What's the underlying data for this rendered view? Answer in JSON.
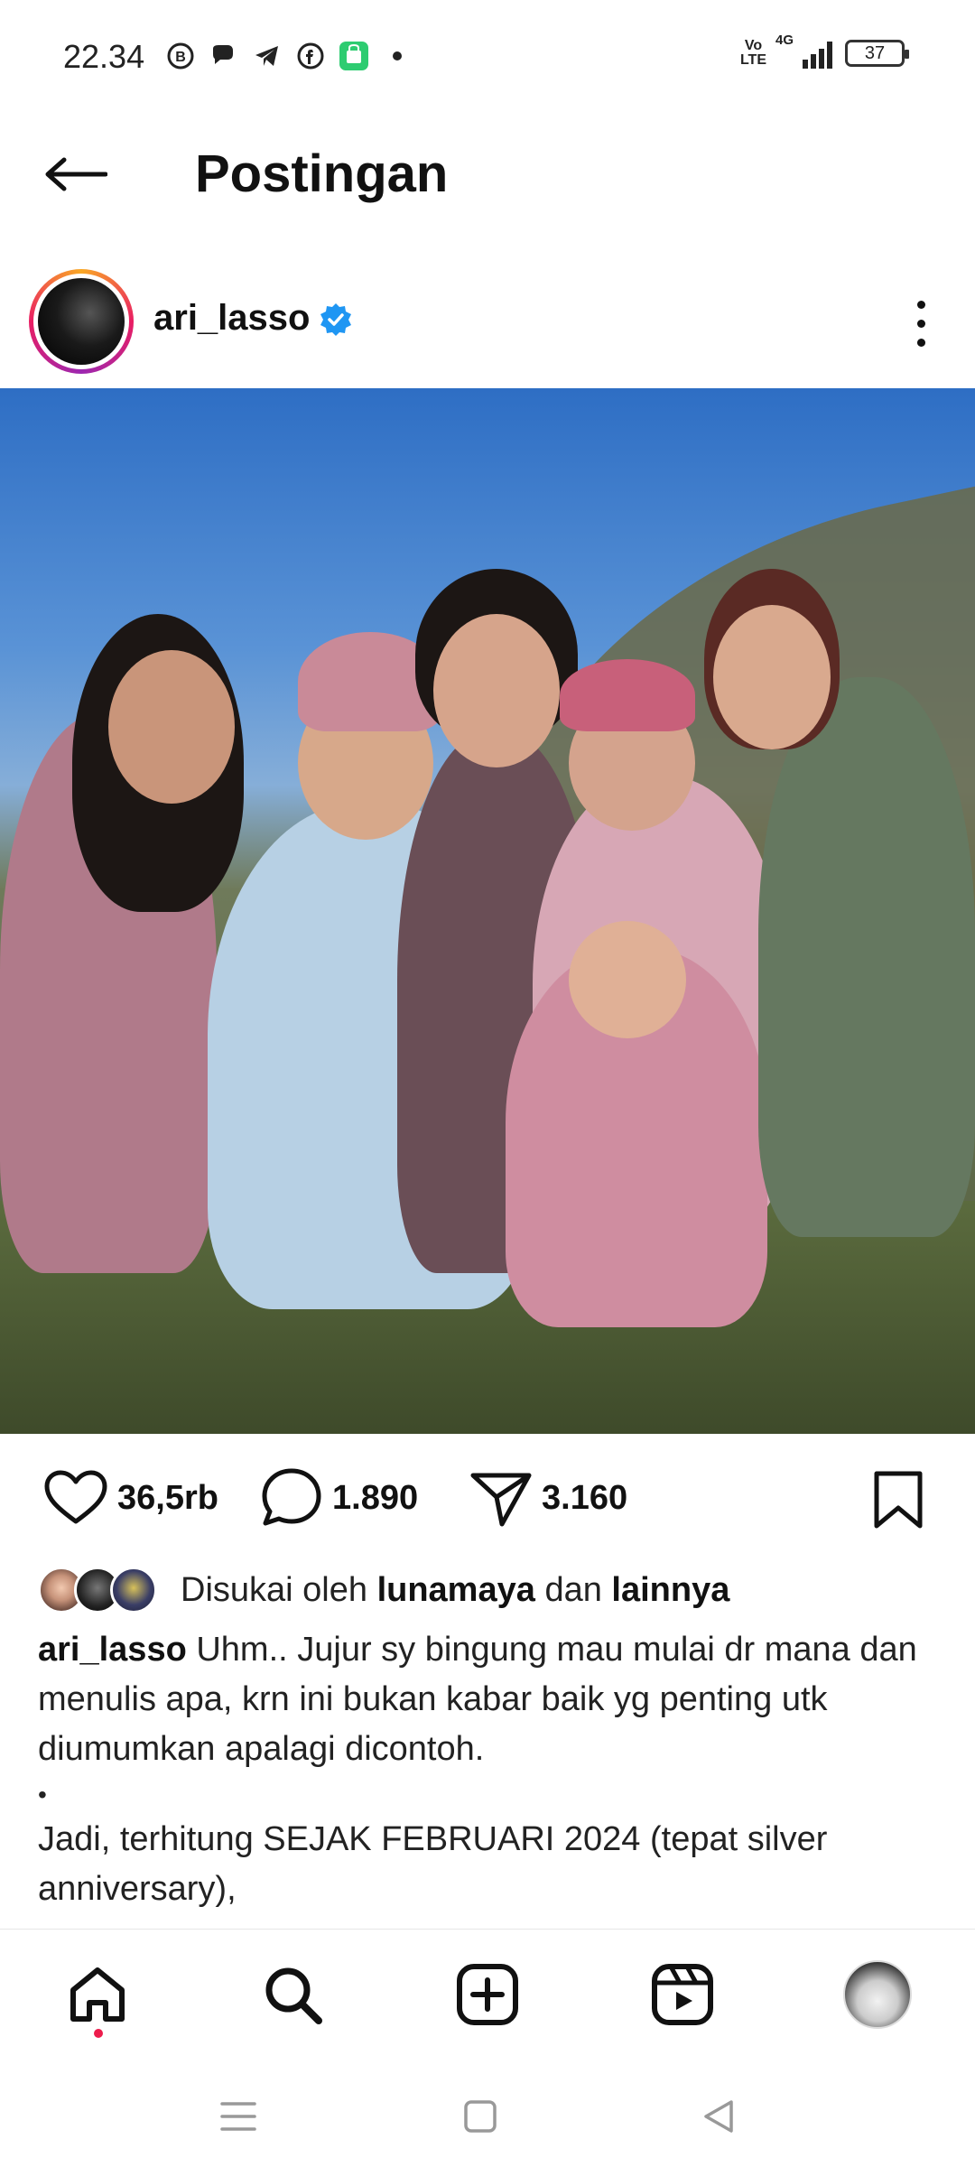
{
  "status_bar": {
    "time": "22.34",
    "network": "4G",
    "volte_top": "Vo",
    "volte_bottom": "LTE",
    "battery": "37"
  },
  "header": {
    "title": "Postingan"
  },
  "post": {
    "username": "ari_lasso",
    "verified": true,
    "stats": {
      "likes": "36,5rb",
      "comments": "1.890",
      "shares": "3.160"
    },
    "liked_by": {
      "prefix": "Disukai oleh",
      "user": "lunamaya",
      "connector": "dan",
      "others": "lainnya"
    },
    "caption": {
      "username": "ari_lasso",
      "line1": "Uhm.. Jujur sy bingung mau mulai dr mana dan menulis apa, krn ini bukan kabar baik yg penting utk diumumkan apalagi dicontoh.",
      "bullet": "•",
      "line2": "Jadi, terhitung SEJAK FEBRUARI 2024 (tepat silver anniversary),"
    }
  },
  "icons": {
    "back": "arrow-left-icon",
    "more": "more-vertical-icon",
    "like": "heart-icon",
    "comment": "comment-icon",
    "share": "send-icon",
    "save": "bookmark-icon",
    "nav": [
      "home-icon",
      "search-icon",
      "add-icon",
      "reels-icon",
      "profile-icon"
    ]
  },
  "colors": {
    "verified": "#1f96f3",
    "notification_dot": "#ed1c4c",
    "accent": "#111111"
  }
}
